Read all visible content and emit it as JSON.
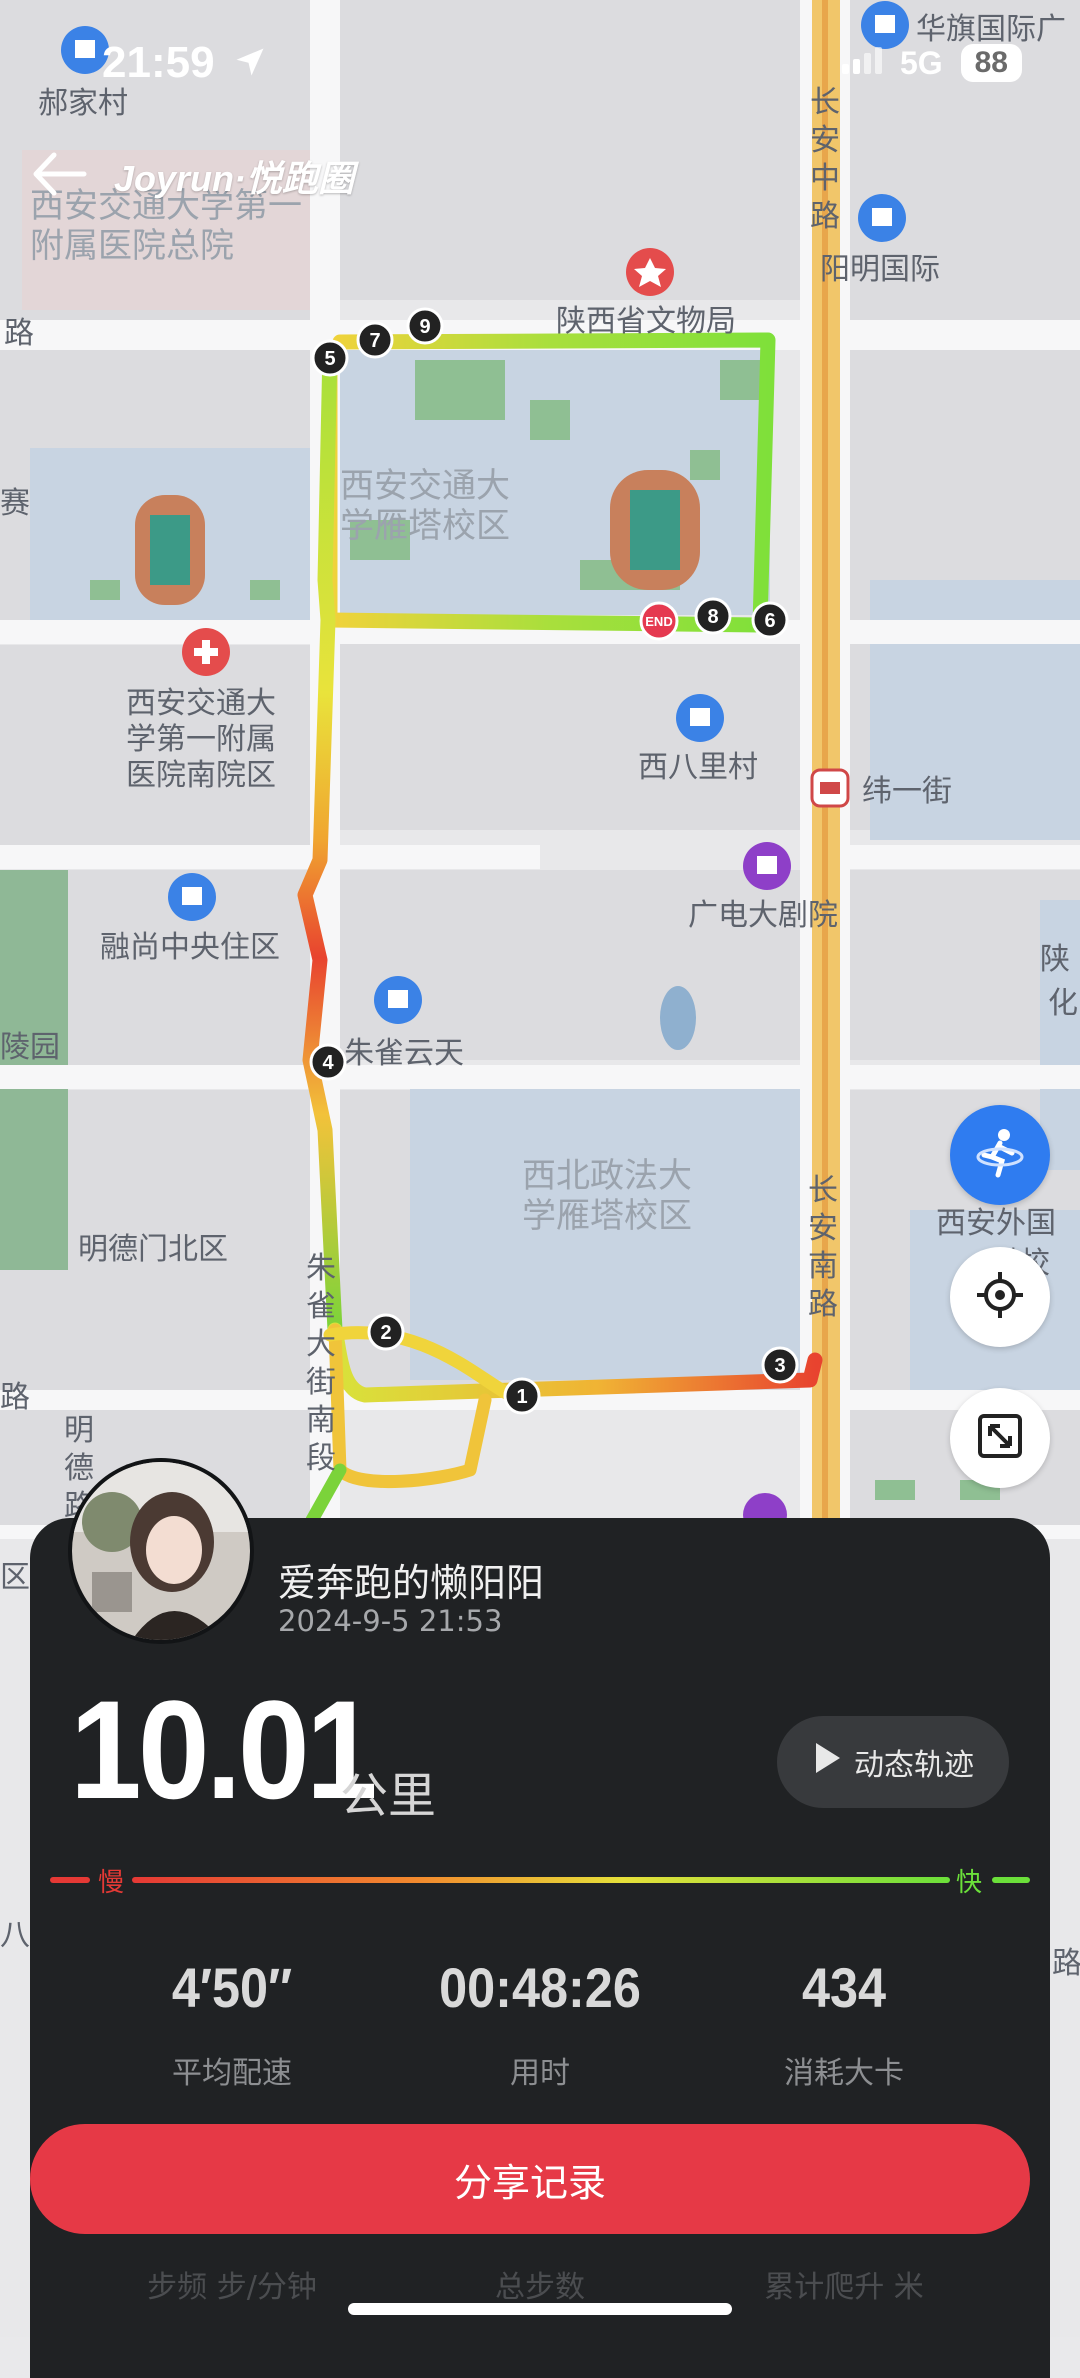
{
  "status_bar": {
    "time": "21:59",
    "network": "5G",
    "battery": "88"
  },
  "header": {
    "brand": "Joyrun·悦跑圈"
  },
  "map": {
    "labels": {
      "hao_jia_cun": "郝家村",
      "hua_qi": "华旗国际广",
      "chang_an_zhong_lu": "长安中路",
      "hospital_general": "西安交通大学第一附属医院总院",
      "yang_ming": "阳明国际",
      "museum": "陕西省文物局",
      "lu_left": "路",
      "sai": "赛",
      "campus_yanta": "西安交通大学雁塔校区",
      "hospital_south": "西安交通大学第一附属医院南院区",
      "xi_ba_li": "西八里村",
      "wei_yi_jie": "纬一街",
      "guang_dian": "广电大剧院",
      "rong_shang": "融尚中央住区",
      "shan": "陕",
      "hua": "化",
      "ling_yuan": "陵园",
      "zhu_que_yun_tian": "朱雀云天",
      "campus_zhengfa": "西北政法大学雁塔校区",
      "chang_an_nan_lu": "长安南路",
      "ming_de_men": "明德门北区",
      "xian_waiguo": "西安外国",
      "xuan_ta": "塔校",
      "zhu_que_da_jie": "朱雀大街南段",
      "ming_de_lu": "明德路",
      "qu": "区",
      "lu_left2": "路",
      "ba": "八",
      "lu_right": "路"
    },
    "markers": [
      "5",
      "7",
      "9",
      "END",
      "8",
      "6",
      "4",
      "2",
      "1",
      "3"
    ]
  },
  "profile": {
    "name": "爱奔跑的懒阳阳",
    "date": "2024-9-5 21:53"
  },
  "run": {
    "distance": "10.01",
    "distance_unit": "公里",
    "replay_label": "动态轨迹"
  },
  "speed_legend": {
    "slow": "慢",
    "fast": "快"
  },
  "stats": [
    {
      "value": "4′50″",
      "label": "平均配速"
    },
    {
      "value": "00:48:26",
      "label": "用时"
    },
    {
      "value": "434",
      "label": "消耗大卡"
    }
  ],
  "share_label": "分享记录",
  "faint_row": [
    "步频 步/分钟",
    "总步数",
    "累计爬升 米"
  ],
  "colors": {
    "share": "#e63946",
    "panel": "#202224",
    "accent_blue": "#2f7cf0",
    "slow": "#e53935",
    "fast": "#6be03a"
  },
  "icons": [
    "back-arrow-icon",
    "location-arrow-icon",
    "signal-icon",
    "run-mode-icon",
    "locate-icon",
    "expand-icon",
    "play-icon"
  ]
}
